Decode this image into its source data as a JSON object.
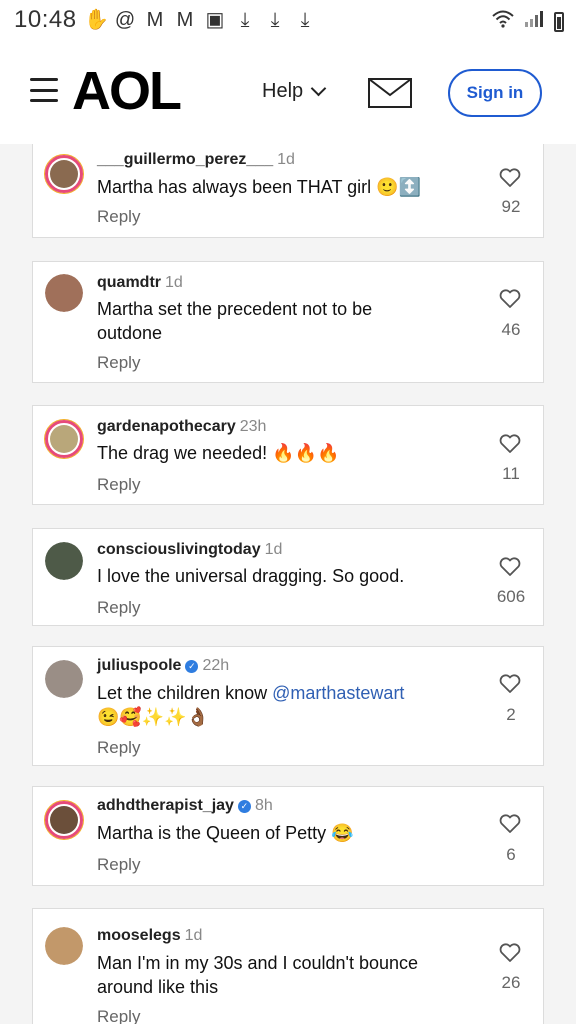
{
  "status_bar": {
    "time": "10:48",
    "left_icons": [
      "hand-icon",
      "at-icon",
      "gmail-icon",
      "gmail-icon",
      "image-icon",
      "download-icon",
      "download-icon",
      "download-icon"
    ],
    "right_icons": [
      "wifi-icon",
      "signal-icon",
      "battery-icon"
    ]
  },
  "header": {
    "logo": "AOL",
    "help_label": "Help",
    "signin_label": "Sign in",
    "accent_color": "#1f5bd1"
  },
  "comments": [
    {
      "user": "___guillermo_perez___",
      "time": "1d",
      "verified": false,
      "text": "Martha has always been THAT girl",
      "emoji": "🙂↕️",
      "likes": "92",
      "reply": "Reply",
      "avatar_ring": true
    },
    {
      "user": "quamdtr",
      "time": "1d",
      "verified": false,
      "text": "Martha set the precedent not to be outdone",
      "emoji": "",
      "likes": "46",
      "reply": "Reply",
      "avatar_ring": false
    },
    {
      "user": "gardenapothecary",
      "time": "23h",
      "verified": false,
      "text": "The drag we needed!",
      "emoji": "🔥🔥🔥",
      "likes": "11",
      "reply": "Reply",
      "avatar_ring": true
    },
    {
      "user": "consciouslivingtoday",
      "time": "1d",
      "verified": false,
      "text": "I love the universal dragging. So good.",
      "emoji": "",
      "likes": "606",
      "reply": "Reply",
      "avatar_ring": false
    },
    {
      "user": "juliuspoole",
      "time": "22h",
      "verified": true,
      "text": "Let the children know",
      "mention": "@marthastewart",
      "emoji": "😉🥰✨✨👌🏾",
      "likes": "2",
      "reply": "Reply",
      "avatar_ring": false
    },
    {
      "user": "adhdtherapist_jay",
      "time": "8h",
      "verified": true,
      "text": "Martha is the Queen of Petty",
      "emoji": "😂",
      "likes": "6",
      "reply": "Reply",
      "avatar_ring": true
    },
    {
      "user": "mooselegs",
      "time": "1d",
      "verified": false,
      "text": "Man I'm in my 30s and I couldn't bounce around like this",
      "emoji": "",
      "likes": "26",
      "reply": "Reply",
      "avatar_ring": false
    }
  ]
}
